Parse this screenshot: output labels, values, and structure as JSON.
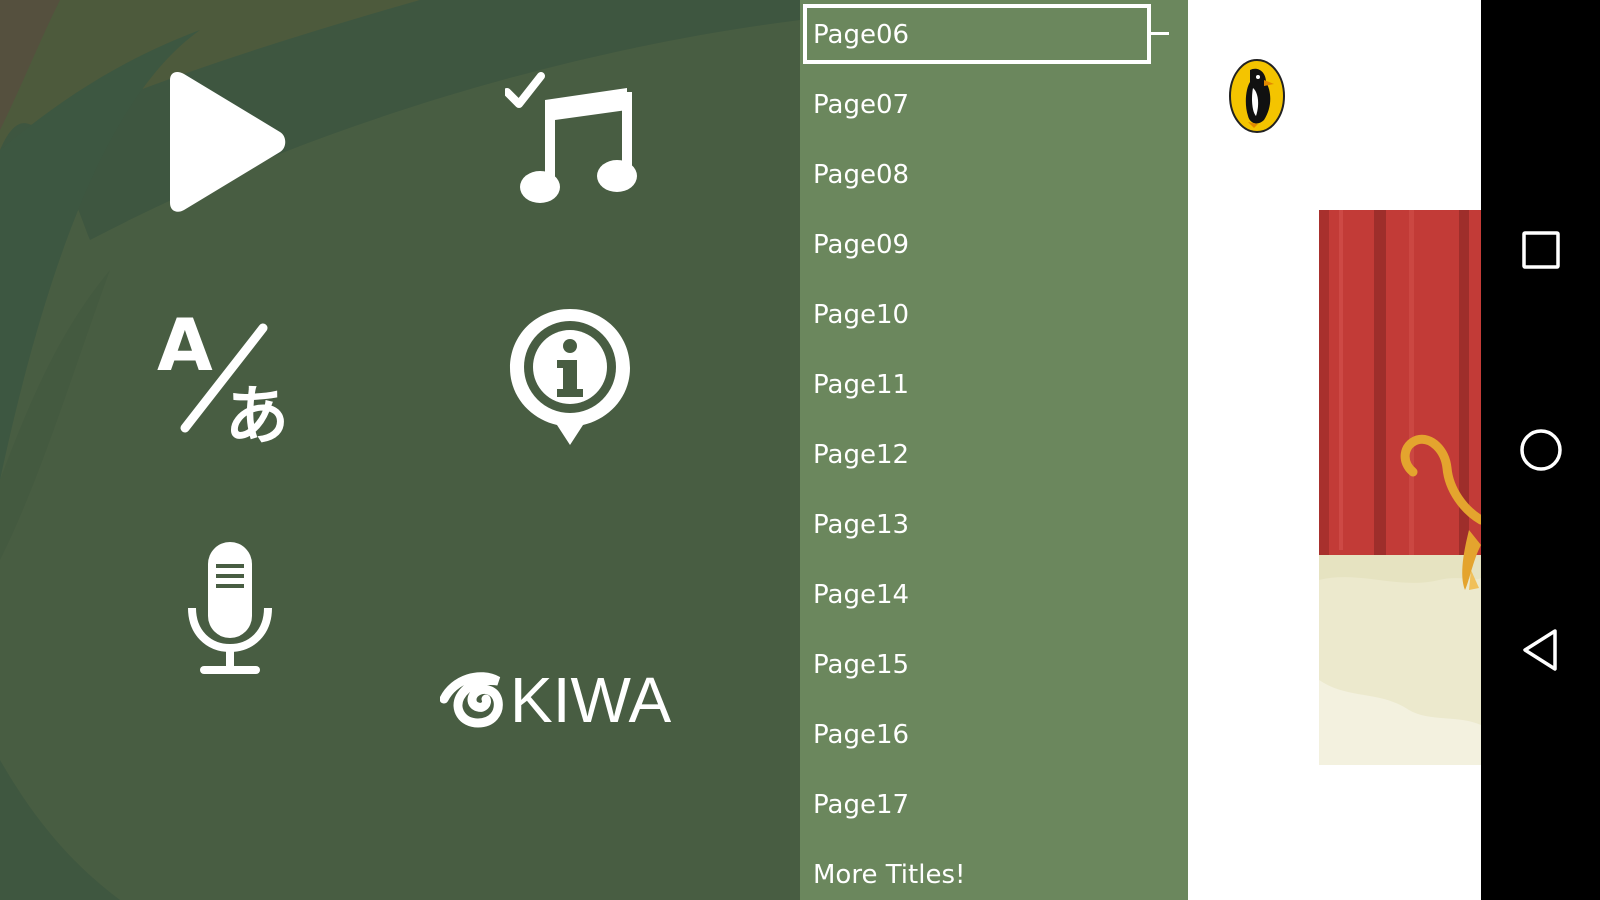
{
  "menu": {
    "buttons": [
      {
        "name": "play-button",
        "icon": "play-icon"
      },
      {
        "name": "music-toggle-button",
        "icon": "music-check-icon"
      },
      {
        "name": "language-button",
        "icon": "translate-icon"
      },
      {
        "name": "info-button",
        "icon": "info-icon"
      },
      {
        "name": "record-button",
        "icon": "microphone-icon"
      }
    ],
    "brand": "KIWA"
  },
  "page_list": {
    "selected": "Page06",
    "items": [
      "Page06",
      "Page07",
      "Page08",
      "Page09",
      "Page10",
      "Page11",
      "Page12",
      "Page13",
      "Page14",
      "Page15",
      "Page16",
      "Page17",
      "More Titles!"
    ]
  },
  "book": {
    "publisher_icon": "penguin-puffin-logo"
  },
  "nav_bar": {
    "buttons": [
      "recents-icon",
      "home-icon",
      "back-icon"
    ]
  },
  "colors": {
    "menu_bg": "#485d42",
    "list_bg": "#6b875d",
    "icon": "#ffffff"
  }
}
